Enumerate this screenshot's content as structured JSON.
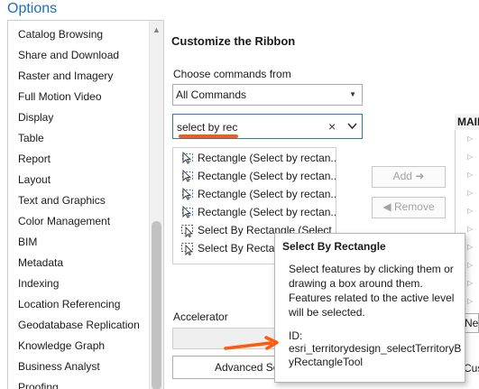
{
  "window": {
    "title": "Options"
  },
  "sidebar": {
    "items": [
      {
        "label": "Catalog Browsing"
      },
      {
        "label": "Share and Download"
      },
      {
        "label": "Raster and Imagery"
      },
      {
        "label": "Full Motion Video"
      },
      {
        "label": "Display"
      },
      {
        "label": "Table"
      },
      {
        "label": "Report"
      },
      {
        "label": "Layout"
      },
      {
        "label": "Text and Graphics"
      },
      {
        "label": "Color Management"
      },
      {
        "label": "BIM"
      },
      {
        "label": "Metadata"
      },
      {
        "label": "Indexing"
      },
      {
        "label": "Location Referencing"
      },
      {
        "label": "Geodatabase Replication"
      },
      {
        "label": "Knowledge Graph"
      },
      {
        "label": "Business Analyst"
      },
      {
        "label": "Proofing"
      }
    ]
  },
  "panel": {
    "heading": "Customize the Ribbon",
    "choose_label": "Choose commands from",
    "choose_value": "All Commands",
    "search_value": "select by rec",
    "clear_glyph": "×",
    "results": [
      {
        "label": "Rectangle (Select by rectan...",
        "icon": "select-rectangle-icon"
      },
      {
        "label": "Rectangle (Select by rectan...",
        "icon": "select-rectangle-icon"
      },
      {
        "label": "Rectangle (Select by rectan...",
        "icon": "select-rectangle-icon"
      },
      {
        "label": "Rectangle (Select by rectan...",
        "icon": "select-rectangle-icon"
      },
      {
        "label": "Select By Rectangle (Select",
        "icon": "select-by-rectangle-icon"
      },
      {
        "label": "Select By Rectangle",
        "icon": "select-by-rectangle-icon"
      }
    ],
    "add_label": "Add",
    "remove_label": "Remove",
    "main_header": "MAIN",
    "accelerator_label": "Accelerator",
    "advanced_label": "Advanced Settings",
    "new_label": "New",
    "customize_label": "Customize"
  },
  "tooltip": {
    "title": "Select By Rectangle",
    "description": "Select features by clicking them or drawing a box around them. Features related to the active level will be selected.",
    "id_label": "ID:",
    "id_value": "esri_territorydesign_selectTerritoryByRectangleTool"
  },
  "colors": {
    "accent": "#1f6fb5",
    "highlight": "#ff5a0a",
    "focus_border": "#2f74c0"
  }
}
